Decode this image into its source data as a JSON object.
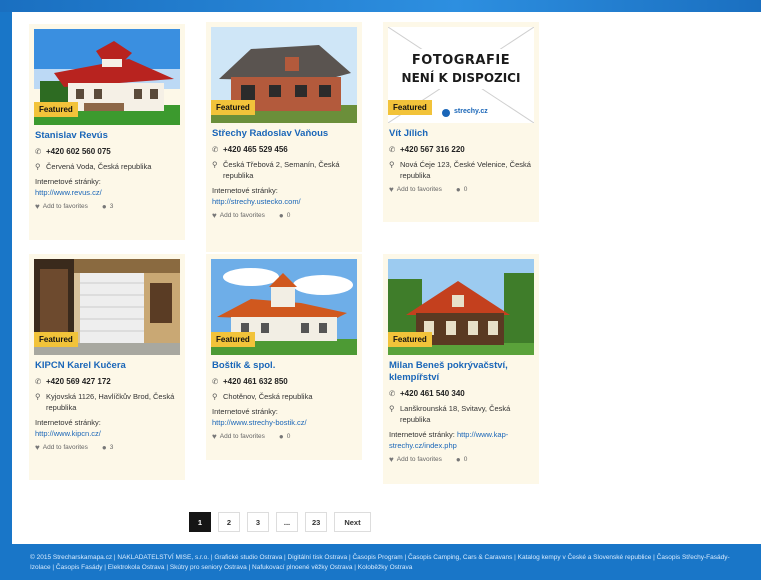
{
  "listings": [
    {
      "badge": "Featured",
      "name": "Stanislav Revús",
      "phone": "+420 602 560 075",
      "address": "Červená Voda, Česká republika",
      "web_label": "Internetové stránky:",
      "web_url": "http://www.revus.cz/",
      "favorites_label": "Add to favorites",
      "comments": "3"
    },
    {
      "badge": "Featured",
      "name": "Střechy Radoslav Vaňous",
      "phone": "+420 465 529 456",
      "address": "Česká Třebová 2, Semanín, Česká republika",
      "web_label": "Internetové stránky:",
      "web_url": "http://strechy.ustecko.com/",
      "favorites_label": "Add to favorites",
      "comments": "0"
    },
    {
      "badge": "Featured",
      "name": "Vít Jílich",
      "phone": "+420 567 316 220",
      "address": "Nová Ćeje 123, České Velenice, Česká republika",
      "favorites_label": "Add to favorites",
      "comments": "0",
      "placeholder_line1": "FOTOGRAFIE",
      "placeholder_line2": "NENÍ K DISPOZICI",
      "placeholder_logo": "strechy.cz"
    },
    {
      "badge": "Featured",
      "name": "KIPCN Karel Kučera",
      "phone": "+420 569 427 172",
      "address": "Kyjovská 1126, Havlíčkův Brod, Česká republika",
      "web_label": "Internetové stránky:",
      "web_url": "http://www.kipcn.cz/",
      "favorites_label": "Add to favorites",
      "comments": "3"
    },
    {
      "badge": "Featured",
      "name": "Boštík & spol.",
      "phone": "+420 461 632 850",
      "address": "Chotěnov, Česká republika",
      "web_label": "Internetové stránky:",
      "web_url": "http://www.strechy-bostik.cz/",
      "favorites_label": "Add to favorites",
      "comments": "0"
    },
    {
      "badge": "Featured",
      "name": "Milan Beneš pokrývačství, klempířství",
      "phone": "+420 461 540 340",
      "address": "Lanškrounská 18, Svitavy, Česká republika",
      "web_label": "Internetové stránky:",
      "web_url": "http://www.kap-strechy.cz/index.php",
      "favorites_label": "Add to favorites",
      "comments": "0"
    }
  ],
  "pagination": {
    "pages": [
      "1",
      "2",
      "3",
      "...",
      "23"
    ],
    "next": "Next",
    "active": "1"
  },
  "footer": {
    "text": "© 2015 Strecharskamapa.cz | NAKLADATELSTVÍ MISE, s.r.o. | Grafické studio Ostrava | Digitální tisk Ostrava | Časopis Program | Časopis Camping, Cars & Caravans | Katalog kempy v České a Slovenské republice | Časopis Střechy-Fasády-Izolace | Časopis Fasády | Elektrokola Ostrava | Skútry pro seniory Ostrava | Nafukovací plnoené věžky Ostrava | Koloběžky Ostrava"
  },
  "colors": {
    "link": "#1a66b8",
    "badge": "#f2c33a",
    "card_bg": "#fdf8e8",
    "frame_blue": "#1976c8"
  },
  "icons": {
    "phone": "phone-icon",
    "address": "map-pin-icon",
    "favorite": "heart-icon",
    "comments": "comment-icon"
  }
}
